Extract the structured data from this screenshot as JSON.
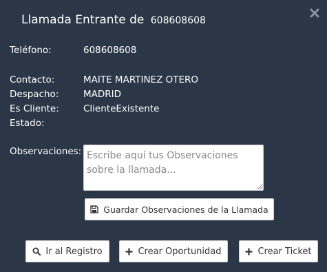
{
  "dialog": {
    "title": "Llamada Entrante de",
    "title_number": "608608608",
    "close_icon": "close-icon"
  },
  "fields": {
    "telefono_label": "Teléfono:",
    "telefono_value": "608608608",
    "contacto_label": "Contacto:",
    "contacto_value": "MAITE MARTINEZ OTERO",
    "despacho_label": "Despacho:",
    "despacho_value": "MADRID",
    "cliente_label": "Es Cliente:",
    "cliente_value": "ClienteExistente",
    "estado_label": "Estado:",
    "estado_value": ""
  },
  "observaciones": {
    "label": "Observaciones:",
    "placeholder": "Escribe aquí tus Observaciones sobre la llamada...",
    "value": ""
  },
  "buttons": {
    "save_label": "Guardar Observaciones de la Llamada",
    "save_icon": "floppy-disk-icon",
    "registro_label": "Ir al Registro",
    "registro_icon": "search-icon",
    "oportunidad_label": "Crear Oportunidad",
    "oportunidad_icon": "plus-icon",
    "ticket_label": "Crear Ticket",
    "ticket_icon": "plus-icon"
  },
  "colors": {
    "background": "#2b3747",
    "text": "#ffffff",
    "button_background": "#ffffff",
    "button_text": "#333333"
  }
}
